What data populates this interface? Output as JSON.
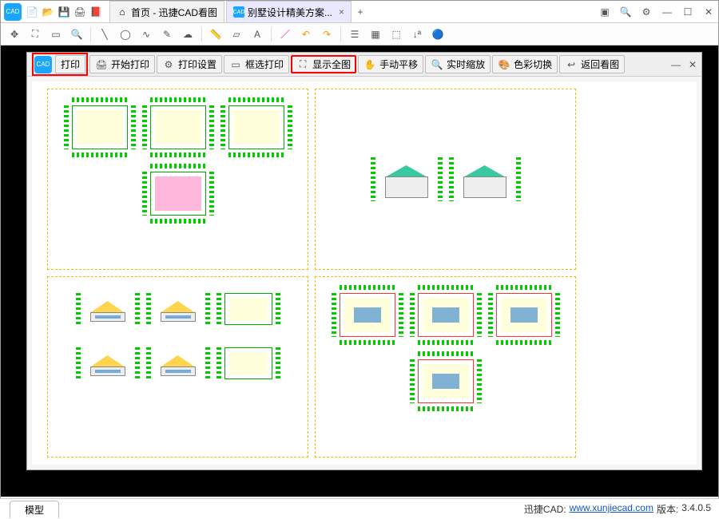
{
  "title_tabs": {
    "home": "首页 - 迅捷CAD看图",
    "file": "别墅设计精美方案..."
  },
  "print_bar": {
    "print": "打印",
    "start_print": "开始打印",
    "print_settings": "打印设置",
    "box_print": "框选打印",
    "show_all": "显示全图",
    "pan": "手动平移",
    "zoom": "实时缩放",
    "color": "色彩切换",
    "back": "返回看图"
  },
  "footer": {
    "model": "模型",
    "brand": "迅捷CAD:",
    "url": "www.xunjiecad.com",
    "ver_label": "版本:",
    "ver": "3.4.0.5"
  }
}
